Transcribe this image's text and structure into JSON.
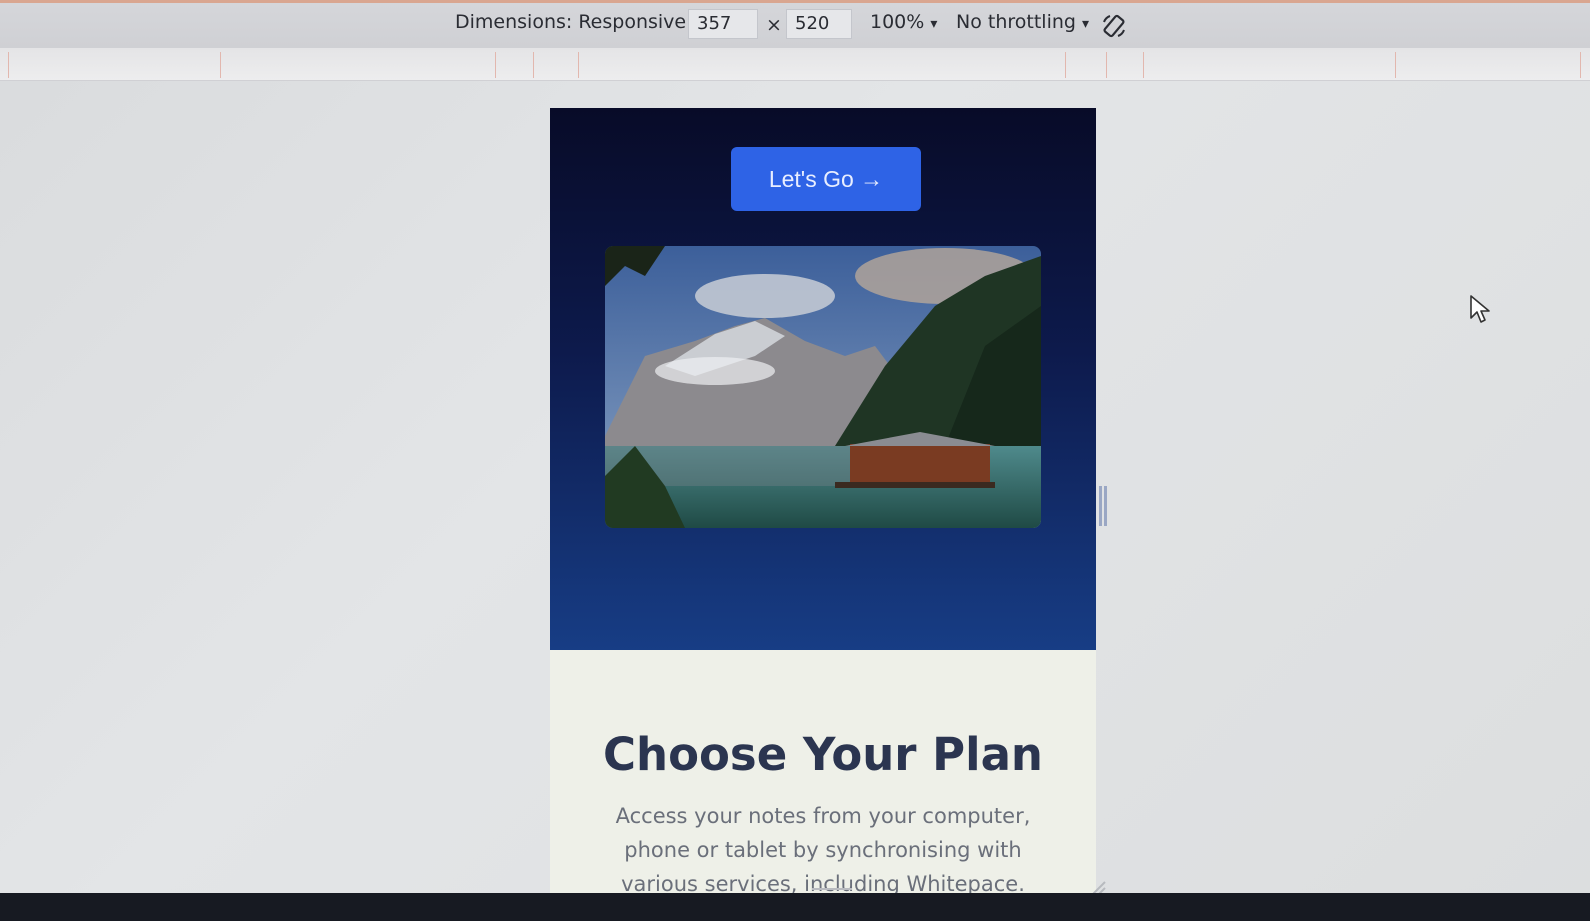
{
  "toolbar": {
    "dimensions_label": "Dimensions: Responsive",
    "width_value": "357",
    "times": "×",
    "height_value": "520",
    "zoom": "100%",
    "throttling": "No throttling",
    "rotate_icon": "rotate-icon",
    "caret": "▾"
  },
  "hero": {
    "cta_label": "Let's Go →",
    "cta_color": "#2e63e6",
    "photo_icon": "mountain-lake-photo"
  },
  "content": {
    "title": "Choose Your Plan",
    "description": "Access your notes from your computer, phone or tablet by synchronising with various services, including Whitepace."
  },
  "colors": {
    "hero_top": "#080b28",
    "hero_bottom": "#173d85",
    "title": "#2b3550",
    "body_text": "#6a6f7a"
  }
}
